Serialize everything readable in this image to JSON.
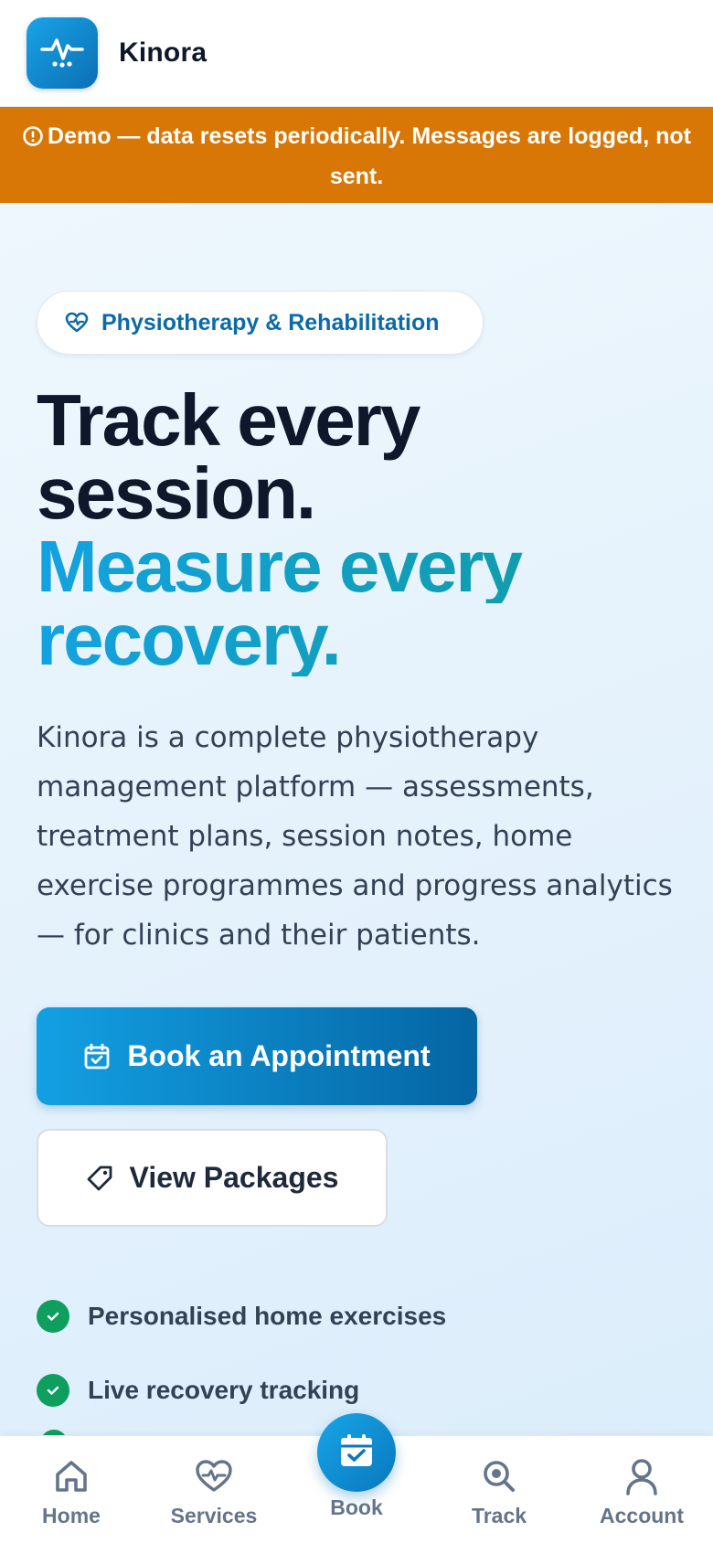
{
  "header": {
    "brand": "Kinora",
    "logo_icon": "pulse-icon"
  },
  "banner": {
    "text": "Demo — data resets periodically. Messages are logged, not sent.",
    "color": "#d97706"
  },
  "hero": {
    "badge": "Physiotherapy & Rehabilitation",
    "headline_line1": "Track every",
    "headline_line2": "session.",
    "headline_line3": "Measure every",
    "headline_line4": "recovery.",
    "description": "Kinora is a complete physiotherapy management platform — assessments, treatment plans, session notes, home exercise programmes and progress analytics — for clinics and their patients.",
    "primary_button": "Book an Appointment",
    "secondary_button": "View Packages",
    "features": [
      "Personalised home exercises",
      "Live recovery tracking"
    ]
  },
  "nav": {
    "items": [
      {
        "label": "Home",
        "icon": "home-icon"
      },
      {
        "label": "Services",
        "icon": "heart-pulse-icon"
      },
      {
        "label": "Book",
        "icon": "calendar-check-icon"
      },
      {
        "label": "Track",
        "icon": "search-icon"
      },
      {
        "label": "Account",
        "icon": "user-icon"
      }
    ],
    "accent": "#0b8ad1"
  }
}
